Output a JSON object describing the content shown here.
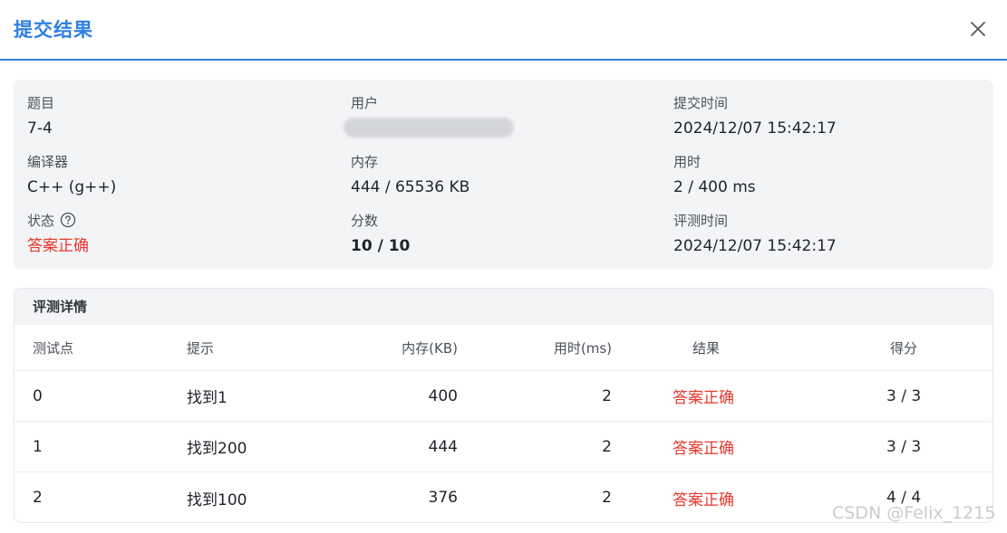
{
  "dialog": {
    "title": "提交结果"
  },
  "info": {
    "problem": {
      "label": "题目",
      "value": "7-4"
    },
    "user": {
      "label": "用户"
    },
    "submit_time": {
      "label": "提交时间",
      "value": "2024/12/07 15:42:17"
    },
    "compiler": {
      "label": "编译器",
      "value": "C++ (g++)"
    },
    "memory": {
      "label": "内存",
      "value": "444 / 65536 KB"
    },
    "time_used": {
      "label": "用时",
      "value": "2 / 400 ms"
    },
    "status": {
      "label": "状态",
      "value": "答案正确"
    },
    "score": {
      "label": "分数",
      "value": "10 / 10"
    },
    "judge_time": {
      "label": "评测时间",
      "value": "2024/12/07 15:42:17"
    }
  },
  "details": {
    "title": "评测详情",
    "headers": [
      "测试点",
      "提示",
      "内存(KB)",
      "用时(ms)",
      "结果",
      "得分"
    ],
    "rows": [
      [
        "0",
        "找到1",
        "400",
        "2",
        "答案正确",
        "3 / 3"
      ],
      [
        "1",
        "找到200",
        "444",
        "2",
        "答案正确",
        "3 / 3"
      ],
      [
        "2",
        "找到100",
        "376",
        "2",
        "答案正确",
        "4 / 4"
      ]
    ]
  },
  "watermark": "CSDN @Felix_1215",
  "colors": {
    "accent": "#2f7fe6",
    "success_text": "#e8382e",
    "panel_bg": "#f3f4f6"
  },
  "icons": {
    "close": "close-icon",
    "status_help": "question-circle-icon"
  }
}
